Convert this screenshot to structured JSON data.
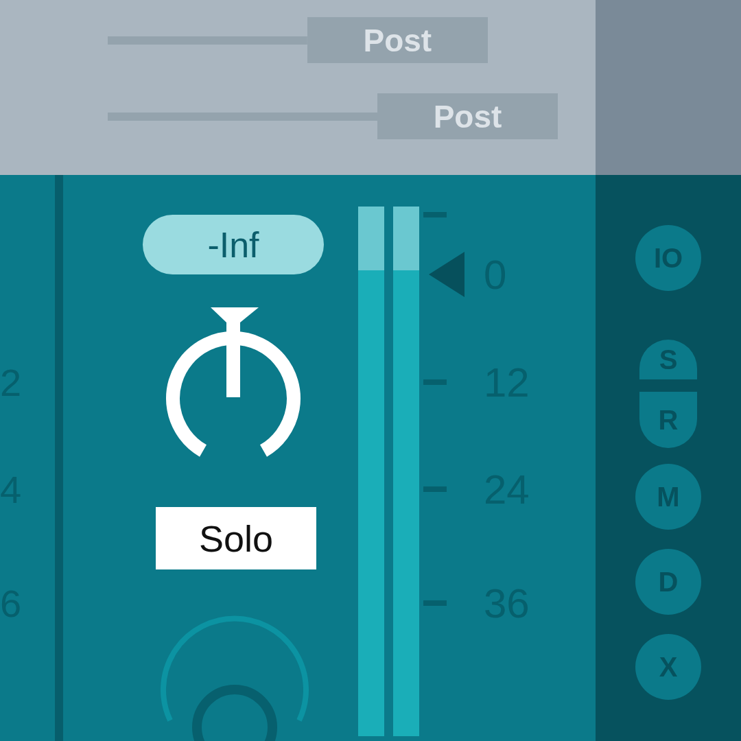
{
  "sends": [
    {
      "label": "Post",
      "level": 0.74
    },
    {
      "label": "Post",
      "level": 1.0
    }
  ],
  "left_strip": {
    "scale_labels": [
      "2",
      "4",
      "6"
    ]
  },
  "channel": {
    "volume": "-Inf",
    "solo": "Solo",
    "meters": [
      {
        "level": 0.88
      },
      {
        "level": 0.88
      }
    ],
    "scale": [
      {
        "kind": "tick"
      },
      {
        "kind": "pointer",
        "label": "0"
      },
      {
        "kind": "tick",
        "label": "12"
      },
      {
        "kind": "tick",
        "label": "24"
      },
      {
        "kind": "tick",
        "label": "36"
      }
    ]
  },
  "side_buttons": [
    {
      "label": "IO",
      "kind": "circle"
    },
    {
      "label": "S",
      "kind": "top"
    },
    {
      "label": "R",
      "kind": "bottom"
    },
    {
      "label": "M",
      "kind": "circle"
    },
    {
      "label": "D",
      "kind": "circle"
    },
    {
      "label": "X",
      "kind": "circle"
    }
  ]
}
